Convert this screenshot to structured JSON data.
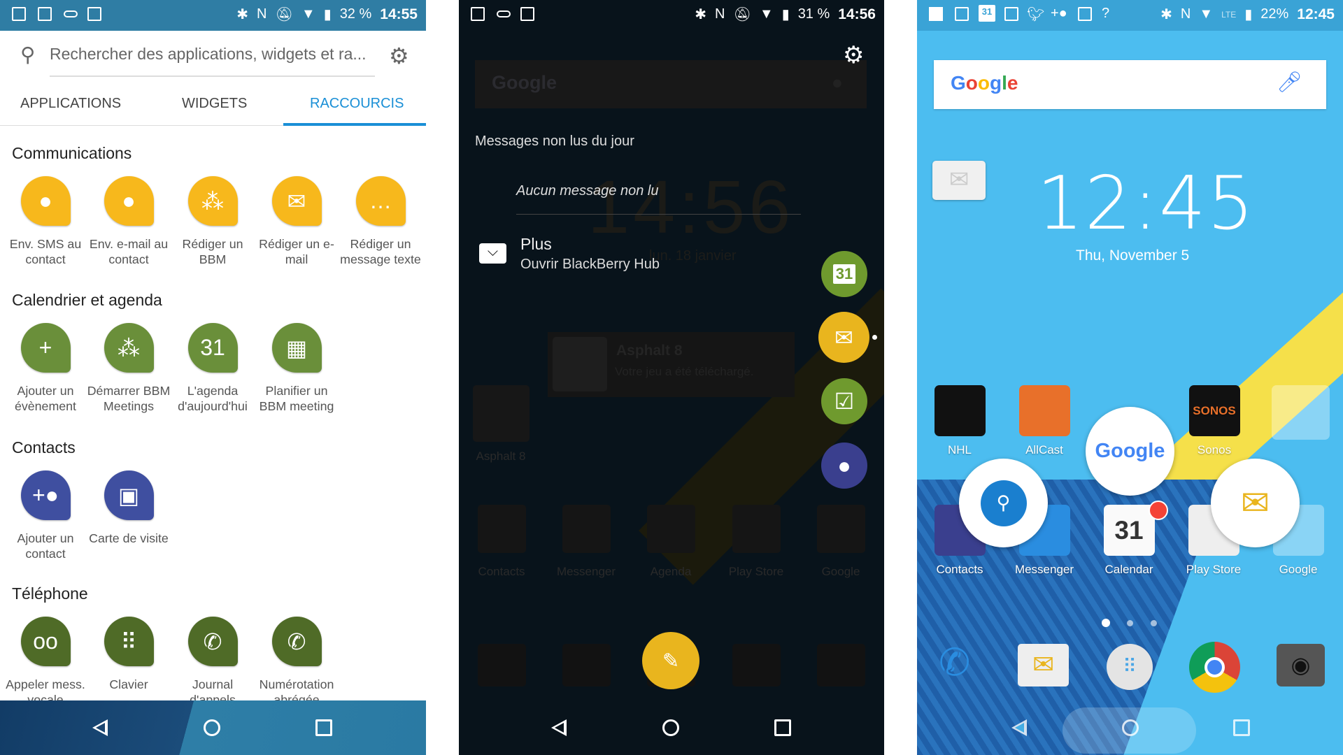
{
  "left": {
    "status": {
      "battery": "32 %",
      "time": "14:55"
    },
    "search_placeholder": "Rechercher des applications, widgets et ra...",
    "tabs": [
      {
        "label": "APPLICATIONS"
      },
      {
        "label": "WIDGETS"
      },
      {
        "label": "RACCOURCIS",
        "active": true
      }
    ],
    "sections": [
      {
        "title": "Communications",
        "color": "#f7b81c",
        "items": [
          {
            "label": "Env. SMS au contact",
            "icon": "contact-sms-icon"
          },
          {
            "label": "Env. e-mail au contact",
            "icon": "contact-email-icon"
          },
          {
            "label": "Rédiger un BBM",
            "icon": "bbm-icon"
          },
          {
            "label": "Rédiger un e-mail",
            "icon": "mail-icon"
          },
          {
            "label": "Rédiger un message texte",
            "icon": "message-icon"
          }
        ]
      },
      {
        "title": "Calendrier et agenda",
        "color": "#6a8f3a",
        "items": [
          {
            "label": "Ajouter un évènement",
            "icon": "calendar-add-icon"
          },
          {
            "label": "Démarrer BBM Meetings",
            "icon": "meeting-icon"
          },
          {
            "label": "L'agenda d'aujourd'hui",
            "icon": "calendar-31-icon"
          },
          {
            "label": "Planifier un BBM meeting",
            "icon": "calendar-grid-icon"
          }
        ]
      },
      {
        "title": "Contacts",
        "color": "#3f4fa0",
        "items": [
          {
            "label": "Ajouter un contact",
            "icon": "add-contact-icon"
          },
          {
            "label": "Carte de visite",
            "icon": "business-card-icon"
          }
        ]
      },
      {
        "title": "Téléphone",
        "color": "#4f6b27",
        "items": [
          {
            "label": "Appeler mess. vocale",
            "icon": "voicemail-icon"
          },
          {
            "label": "Clavier",
            "icon": "dialpad-icon"
          },
          {
            "label": "Journal d'appels",
            "icon": "call-log-icon"
          },
          {
            "label": "Numérotation abrégée",
            "icon": "speed-dial-icon"
          }
        ]
      }
    ],
    "accent": "#1a8fd6"
  },
  "middle": {
    "status": {
      "battery": "31 %",
      "time": "14:56"
    },
    "google_label": "Google",
    "heading": "Messages non lus du jour",
    "empty": "Aucun message non lu",
    "clock_bg": "14:56",
    "date_bg": "lun. 18 janvier",
    "hub_title": "Plus",
    "hub_sub": "Ouvrir BlackBerry Hub",
    "notif_title": "Asphalt 8",
    "notif_body": "Votre jeu a été téléchargé.",
    "asphalt_label": "Asphalt 8",
    "dock": [
      "Contacts",
      "Messenger",
      "Agenda",
      "Play Store",
      "Google"
    ],
    "calendar_day": "31"
  },
  "right": {
    "status": {
      "network": "LTE",
      "battery": "22%",
      "time": "12:45",
      "calendar_day": "31"
    },
    "google_label": "Google",
    "clock": "12:45",
    "date": "Thu, November 5",
    "row1": [
      "NHL",
      "AllCast",
      "Sonos"
    ],
    "row2": [
      "Contacts",
      "Messenger",
      "Calendar",
      "Play Store",
      "Google"
    ],
    "google_bubble": "Google",
    "sonos_logo": "SONOS",
    "calendar_day": "31",
    "pages": {
      "count": 3,
      "current": 1
    }
  }
}
